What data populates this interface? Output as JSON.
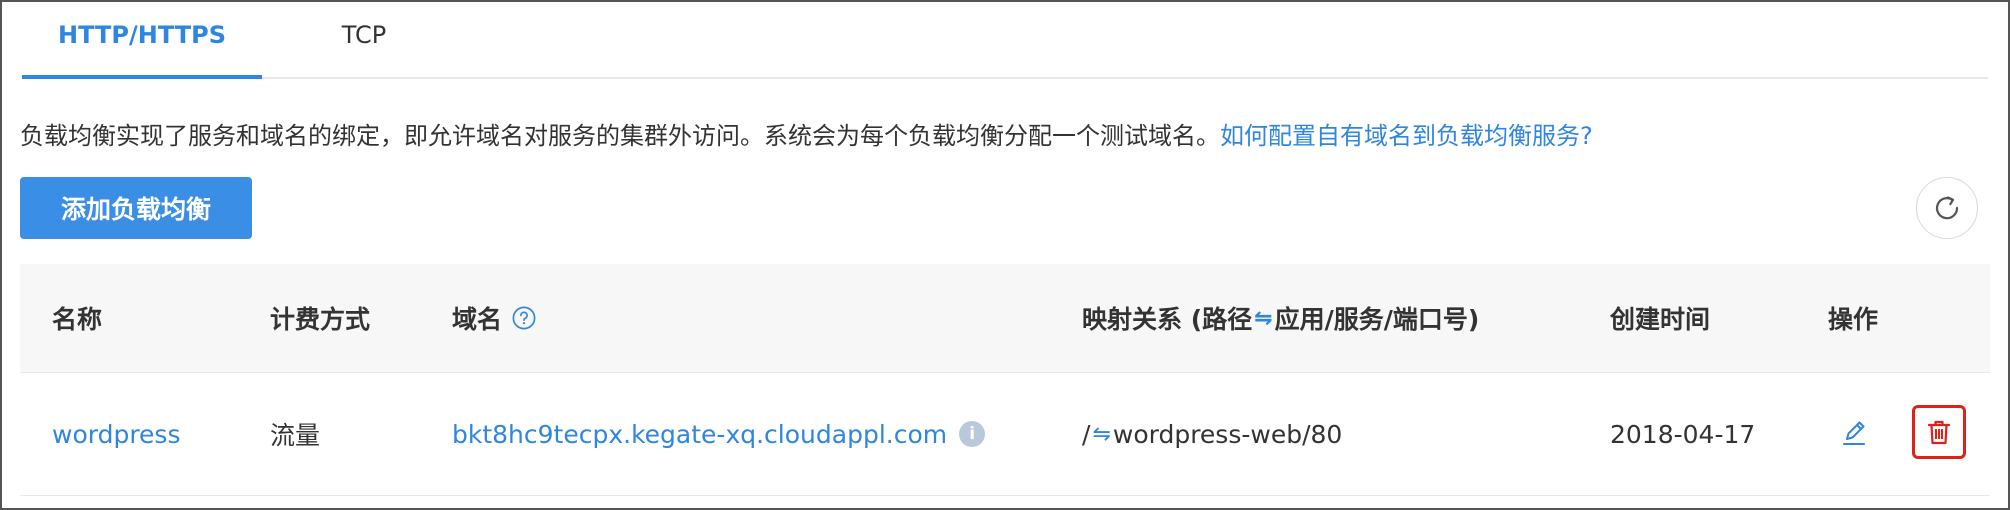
{
  "tabs": [
    {
      "label": "HTTP/HTTPS",
      "active": true
    },
    {
      "label": "TCP",
      "active": false
    }
  ],
  "description": {
    "text": "负载均衡实现了服务和域名的绑定，即允许域名对服务的集群外访问。系统会为每个负载均衡分配一个测试域名。",
    "link": "如何配置自有域名到负载均衡服务?"
  },
  "toolbar": {
    "add_label": "添加负载均衡",
    "refresh_icon": "refresh-icon"
  },
  "table": {
    "headers": {
      "name": "名称",
      "billing": "计费方式",
      "domain": "域名",
      "mapping_prefix": "映射关系 (路径",
      "mapping_arrows": "⇋",
      "mapping_suffix": "应用/服务/端口号)",
      "created": "创建时间",
      "ops": "操作"
    },
    "rows": [
      {
        "name": "wordpress",
        "billing": "流量",
        "domain": "bkt8hc9tecpx.kegate-xq.cloudappl.com",
        "mapping_path": "/",
        "mapping_arrows": "⇋",
        "mapping_target": "wordpress-web/80",
        "created": "2018-04-17",
        "info_glyph": "i"
      }
    ]
  },
  "colors": {
    "accent": "#2f86e1",
    "button": "#3a8ee6",
    "danger": "#e0201a",
    "header_bg": "#f7f7f7"
  }
}
